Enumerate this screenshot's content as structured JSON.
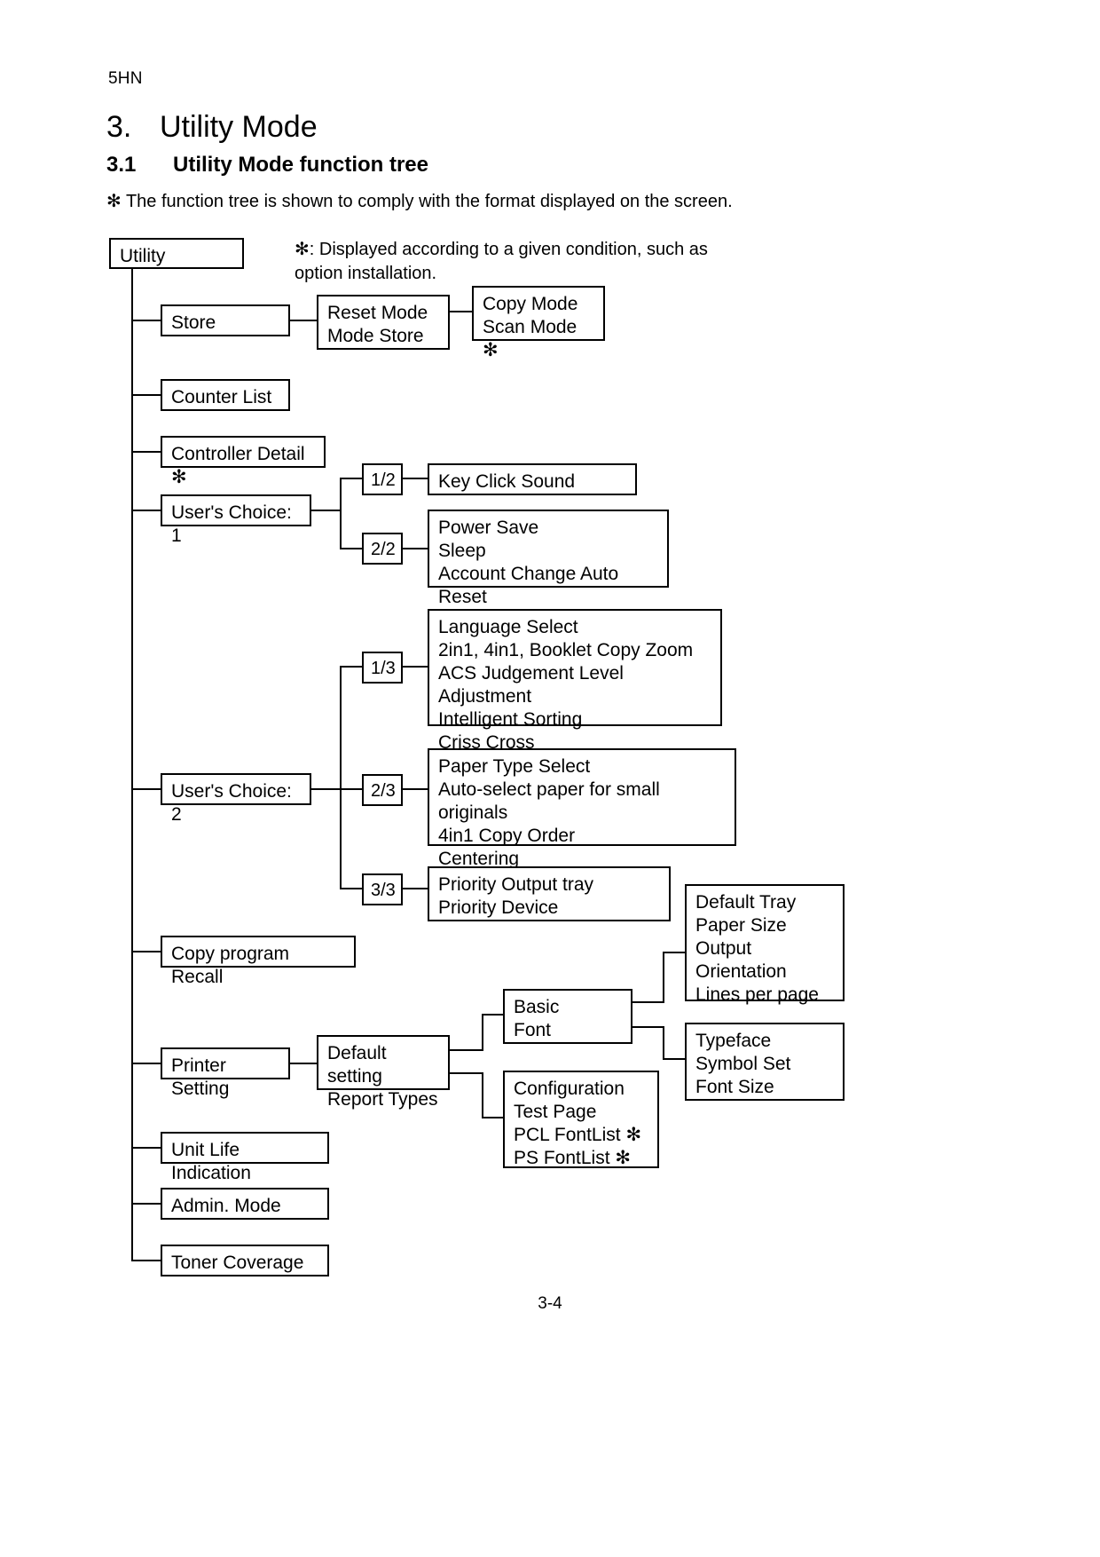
{
  "header": {
    "doc_code": "5HN",
    "chapter_number": "3.",
    "chapter_title": "Utility Mode",
    "section_number": "3.1",
    "section_title": "Utility Mode function tree",
    "note": "✻ The function tree is shown to comply with the format displayed on the screen.",
    "legend": "✻: Displayed according to a given condition, such as\n    option installation.",
    "page_number": "3-4"
  },
  "tree": {
    "root": "Utility",
    "level1": {
      "store": "Store",
      "counter_list": "Counter List",
      "controller_detail": "Controller Detail ✻",
      "users_choice_1": "User's Choice: 1",
      "users_choice_2": "User's Choice: 2",
      "copy_program_recall": "Copy program Recall",
      "printer_setting": "Printer Setting",
      "unit_life_indication": "Unit Life Indication",
      "admin_mode": "Admin. Mode",
      "toner_coverage": "Toner Coverage"
    },
    "store_children": {
      "mode_box": "Reset Mode\nMode Store",
      "copy_scan_box": "Copy Mode\nScan Mode ✻"
    },
    "users_choice_1_pages": {
      "page_1_label": "1/2",
      "page_1_items": "Key Click Sound",
      "page_2_label": "2/2",
      "page_2_items": "Power Save\nSleep\nAccount Change Auto Reset"
    },
    "users_choice_2_pages": {
      "page_1_label": "1/3",
      "page_1_items": "Language Select\n2in1, 4in1, Booklet Copy Zoom\nACS Judgement Level Adjustment\nIntelligent Sorting\nCriss Cross",
      "page_2_label": "2/3",
      "page_2_items": "Paper Type Select\nAuto-select paper for small originals\n4in1 Copy Order\nCentering",
      "page_3_label": "3/3",
      "page_3_items": "Priority Output tray\nPriority Device"
    },
    "printer_setting_children": {
      "default_report_box": "Default setting\nReport Types",
      "basic_font_box": "Basic\nFont",
      "basic_items": "Default Tray\nPaper Size\nOutput\nOrientation\nLines per page",
      "font_items": "Typeface\nSymbol Set\nFont Size",
      "report_items": "Configuration\nTest Page\nPCL FontList ✻\nPS FontList ✻"
    }
  }
}
